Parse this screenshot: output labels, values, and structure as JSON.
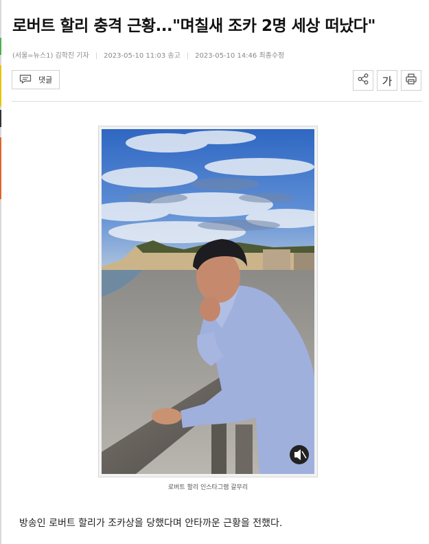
{
  "article": {
    "title": "로버트 할리 충격 근황...\"며칠새 조카 2명 세상 떠났다\"",
    "byline": "(서울=뉴스1) 김학진 기자",
    "published": "2023-05-10 11:03 송고",
    "updated": "2023-05-10 14:46 최종수정",
    "image_caption": "로버트 할리 인스타그램 갈무리",
    "lead_paragraph": "방송인 로버트 할리가 조카상을 당했다며 안타까운 근황을 전했다."
  },
  "toolbar": {
    "comment_label": "댓글",
    "font_size_label": "가",
    "icons": [
      "comment-icon",
      "share-icon",
      "font-size-icon",
      "print-icon"
    ]
  },
  "colors": {
    "text": "#111111",
    "meta": "#888888",
    "border": "#d0d0d0",
    "sky": "#3f77c9",
    "shirt": "#9fb0dd"
  }
}
